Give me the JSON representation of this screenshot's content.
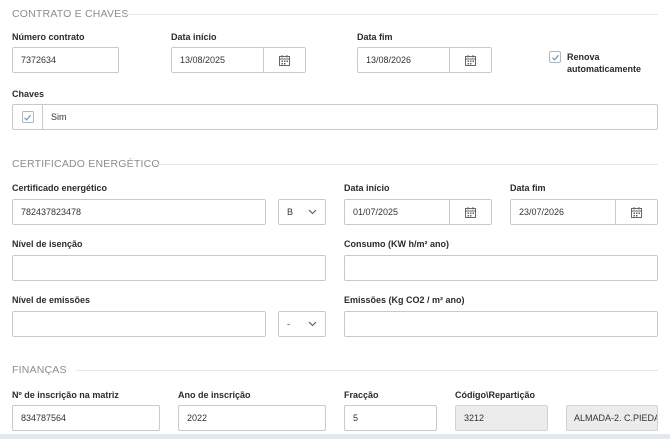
{
  "contrato": {
    "section_title": "CONTRATO E CHAVES",
    "numero_label": "Número contrato",
    "numero_value": "7372634",
    "data_inicio_label": "Data início",
    "data_inicio_value": "13/08/2025",
    "data_fim_label": "Data fim",
    "data_fim_value": "13/08/2026",
    "renova_label": "Renova automaticamente",
    "renova_checked": true,
    "chaves_label": "Chaves",
    "chaves_value": "Sim",
    "chaves_checked": true
  },
  "certificado": {
    "section_title": "CERTIFICADO ENERGÉTICO",
    "cert_label": "Certificado energético",
    "cert_value": "782437823478",
    "classe_value": "B",
    "data_inicio_label": "Data início",
    "data_inicio_value": "01/07/2025",
    "data_fim_label": "Data fim",
    "data_fim_value": "23/07/2026",
    "isencao_label": "Nível de isenção",
    "isencao_value": "",
    "consumo_label": "Consumo (KW h/m² ano)",
    "consumo_value": "",
    "emissoes_nivel_label": "Nível de emissões",
    "emissoes_nivel_value": "",
    "emissoes_classe_value": "-",
    "emissoes_label": "Emissões (Kg CO2 / m² ano)",
    "emissoes_value": ""
  },
  "financas": {
    "section_title": "FINANÇAS",
    "matriz_label": "Nº de inscrição na matriz",
    "matriz_value": "834787564",
    "ano_label": "Ano de inscrição",
    "ano_value": "2022",
    "fraccao_label": "Fracção",
    "fraccao_value": "5",
    "codigo_label": "Código\\Repartição",
    "codigo_value": "3212",
    "reparticao_value": "ALMADA-2. C.PIEDA"
  },
  "icons": {
    "calendar": "calendar-icon",
    "chevron": "chevron-down-icon",
    "check": "checkmark-icon"
  },
  "colors": {
    "check": "#6b9bd1",
    "section_title": "#8c8c8c",
    "border": "#c9c9c9",
    "readonly_bg": "#ececec"
  }
}
